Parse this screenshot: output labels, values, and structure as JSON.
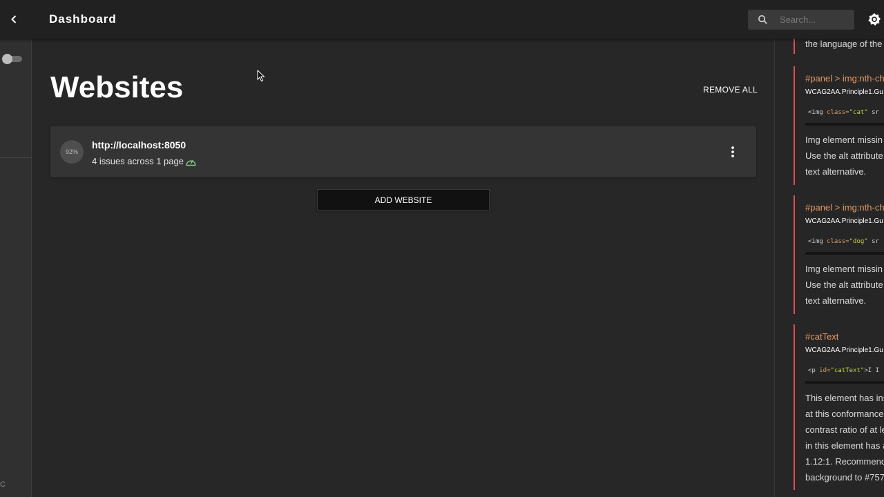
{
  "appbar": {
    "title": "Dashboard",
    "search_placeholder": "Search..."
  },
  "drawer": {
    "footer_char": "C"
  },
  "main": {
    "heading": "Websites",
    "remove_all_label": "REMOVE ALL",
    "add_website_label": "ADD WEBSITE",
    "websites": [
      {
        "score": "92%",
        "url": "http://localhost:8050",
        "summary": "4 issues across 1 page"
      }
    ]
  },
  "issues_panel": {
    "top_text": "the language of the",
    "issues": [
      {
        "selector": "#panel > img:nth-ch",
        "code": "WCAG2AA.Principle1.Gu",
        "snippet_tag": "<img ",
        "snippet_attr": "class=",
        "snippet_val": "\"cat\"",
        "snippet_rest": " sr",
        "lines": [
          "Img element missin",
          "Use the alt attribute",
          "text alternative."
        ]
      },
      {
        "selector": "#panel > img:nth-ch",
        "code": "WCAG2AA.Principle1.Gu",
        "snippet_tag": "<img ",
        "snippet_attr": "class=",
        "snippet_val": "\"dog\"",
        "snippet_rest": " sr",
        "lines": [
          "Img element missin",
          "Use the alt attribute",
          "text alternative."
        ]
      },
      {
        "selector": "#catText",
        "code": "WCAG2AA.Principle1.Gu",
        "snippet_tag": "<p ",
        "snippet_attr": "id=",
        "snippet_val": "\"catText\"",
        "snippet_rest": ">I I",
        "lines": [
          "This element has ins",
          "at this conformance",
          "contrast ratio of at le",
          "in this element has a",
          "1.12:1. Recommend",
          "background to #757"
        ]
      }
    ]
  },
  "colors": {
    "background": "#272727",
    "appbar": "#212121",
    "issue_border": "#e04c5b",
    "selector_text": "#e59a66",
    "speed_icon": "#7fd18b"
  }
}
